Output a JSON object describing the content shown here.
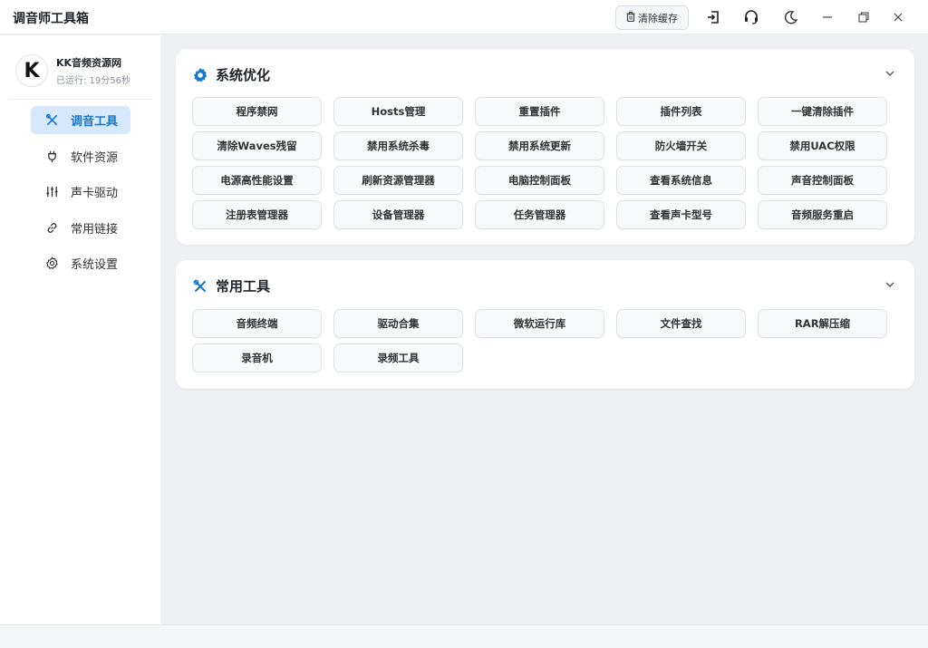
{
  "window": {
    "title": "调音师工具箱",
    "clear_cache_label": "清除缓存",
    "icons": [
      "trash-icon",
      "exit-icon",
      "headset-icon",
      "moon-icon",
      "minimize-icon",
      "restore-icon",
      "close-icon"
    ]
  },
  "profile": {
    "avatar_letter": "K",
    "name": "KK音频资源网",
    "runtime": "已运行: 19分56秒"
  },
  "sidebar": {
    "items": [
      {
        "label": "调音工具",
        "icon": "tools-icon",
        "active": true
      },
      {
        "label": "软件资源",
        "icon": "plug-icon",
        "active": false
      },
      {
        "label": "声卡驱动",
        "icon": "sliders-icon",
        "active": false
      },
      {
        "label": "常用链接",
        "icon": "link-icon",
        "active": false
      },
      {
        "label": "系统设置",
        "icon": "gear-icon",
        "active": false
      }
    ]
  },
  "sections": [
    {
      "title": "系统优化",
      "icon": "gear-icon",
      "buttons": [
        "程序禁网",
        "Hosts管理",
        "重置插件",
        "插件列表",
        "一键清除插件",
        "清除Waves残留",
        "禁用系统杀毒",
        "禁用系统更新",
        "防火墙开关",
        "禁用UAC权限",
        "电源高性能设置",
        "刷新资源管理器",
        "电脑控制面板",
        "查看系统信息",
        "声音控制面板",
        "注册表管理器",
        "设备管理器",
        "任务管理器",
        "查看声卡型号",
        "音频服务重启"
      ]
    },
    {
      "title": "常用工具",
      "icon": "tools-icon",
      "buttons": [
        "音频终端",
        "驱动合集",
        "微软运行库",
        "文件查找",
        "RAR解压缩",
        "录音机",
        "录频工具"
      ]
    }
  ],
  "colors": {
    "accent": "#1677d2",
    "active_bg": "#d6e8fb",
    "background": "#eef0f3"
  }
}
